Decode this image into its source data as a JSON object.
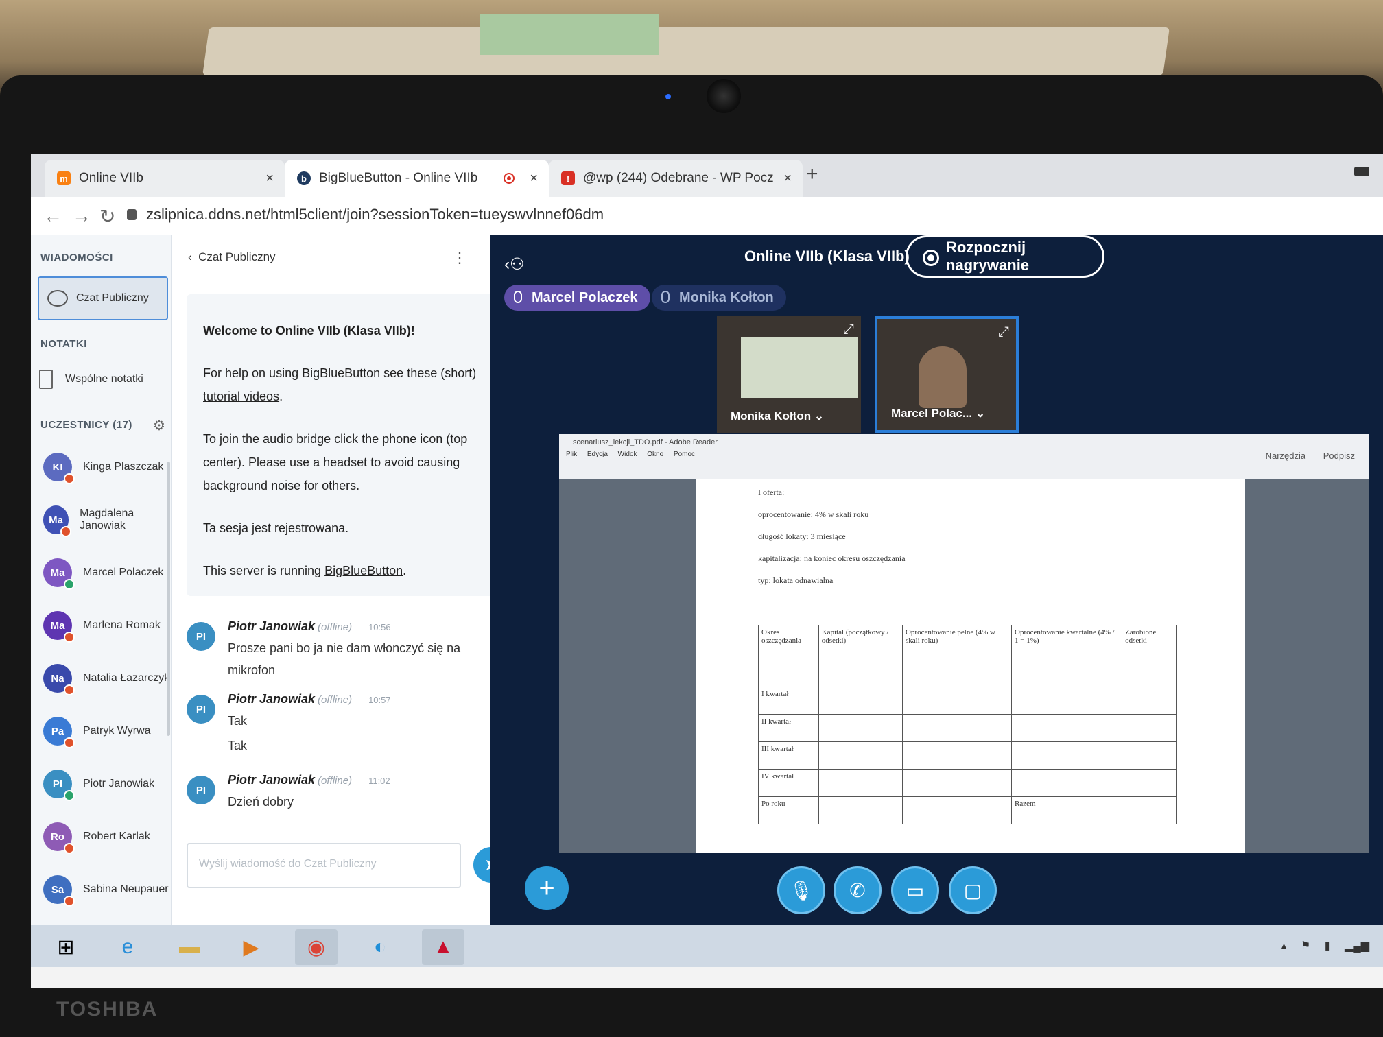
{
  "browser": {
    "tabs": [
      {
        "title": "Online VIIb",
        "close": "×"
      },
      {
        "title": "BigBlueButton - Online VIIb",
        "close": "×"
      },
      {
        "title": "@wp (244) Odebrane - WP Pocz",
        "close": "×"
      }
    ],
    "new_tab": "+",
    "url": "zslipnica.ddns.net/html5client/join?sessionToken=tueyswvlnnef06dm"
  },
  "sidebar": {
    "messages_label": "WIADOMOŚCI",
    "public_chat": "Czat Publiczny",
    "notes_label": "NOTATKI",
    "shared_notes": "Wspólne notatki",
    "users_label": "UCZESTNICY (17)",
    "users": [
      {
        "initials": "KI",
        "name": "Kinga Plaszczak",
        "color": "#5c6bc0",
        "status_color": "#e0522c"
      },
      {
        "initials": "Ma",
        "name": "Magdalena Janowiak",
        "color": "#3f51b5",
        "status_color": "#e0522c"
      },
      {
        "initials": "Ma",
        "name": "Marcel Polaczek",
        "color": "#7e57c2",
        "status_color": "#2aa36b"
      },
      {
        "initials": "Ma",
        "name": "Marlena Romak",
        "color": "#5e35b1",
        "status_color": "#e0522c"
      },
      {
        "initials": "Na",
        "name": "Natalia Łazarczyk",
        "color": "#3949ab",
        "status_color": "#e0522c"
      },
      {
        "initials": "Pa",
        "name": "Patryk Wyrwa",
        "color": "#3a7bd5",
        "status_color": "#e0522c"
      },
      {
        "initials": "PI",
        "name": "Piotr Janowiak",
        "color": "#3a8fc2",
        "status_color": "#2aa36b"
      },
      {
        "initials": "Ro",
        "name": "Robert Karlak",
        "color": "#8e5bb5",
        "status_color": "#e0522c"
      },
      {
        "initials": "Sa",
        "name": "Sabina Neupauer",
        "color": "#3f6fc0",
        "status_color": "#e0522c"
      }
    ]
  },
  "chat": {
    "header": "Czat Publiczny",
    "welcome": {
      "line1": "Welcome to Online VIIb (Klasa VIIb)!",
      "line2_pre": "For help on using BigBlueButton see these (short) ",
      "line2_link": "tutorial videos",
      "line2_post": ".",
      "line3": "To join the audio bridge click the phone icon (top center). Please use a headset to avoid causing background noise for others.",
      "line4": "Ta sesja jest rejestrowana.",
      "line5_pre": "This server is running ",
      "line5_link": "BigBlueButton",
      "line5_post": "."
    },
    "messages": [
      {
        "initials": "PI",
        "author": "Piotr Janowiak",
        "status": "(offline)",
        "time": "10:56",
        "lines": [
          "Prosze pani bo ja nie dam włonczyć się na mikrofon"
        ]
      },
      {
        "initials": "PI",
        "author": "Piotr Janowiak",
        "status": "(offline)",
        "time": "10:57",
        "lines": [
          "Tak",
          "Tak"
        ]
      },
      {
        "initials": "PI",
        "author": "Piotr Janowiak",
        "status": "(offline)",
        "time": "11:02",
        "lines": [
          "Dzień dobry"
        ]
      }
    ],
    "input_placeholder": "Wyślij wiadomość do Czat Publiczny"
  },
  "main": {
    "meeting_title": "Online VIIb (Klasa VIIb)",
    "record_button": "Rozpocznij nagrywanie",
    "talkers": [
      "Marcel Polaczek",
      "Monika Kołton"
    ],
    "videos": [
      "Monika Kołton",
      "Marcel Polac..."
    ],
    "presentation": {
      "window_title": "scenariusz_lekcji_TDO.pdf - Adobe Reader",
      "menus": "Plik Edycja Widok Okno Pomoc",
      "right_tools": "Narzędzia Podpisz",
      "lines": [
        "I oferta:",
        "oprocentowanie: 4% w skali roku",
        "długość lokaty: 3 miesiące",
        "kapitalizacja: na koniec okresu oszczędzania",
        "typ: lokata odnawialna"
      ],
      "table_headers": [
        "Okres oszczędzania",
        "Kapitał (początkowy / odsetki)",
        "Oprocentowanie pełne (4% w skali roku)",
        "Oprocentowanie kwartalne (4% / 1 = 1%)",
        "Zarobione odsetki"
      ],
      "table_rows": [
        "I kwartał",
        "II kwartał",
        "III kwartał",
        "IV kwartał",
        "Po roku"
      ],
      "table_total": "Razem"
    }
  },
  "brand": "TOSHIBA"
}
